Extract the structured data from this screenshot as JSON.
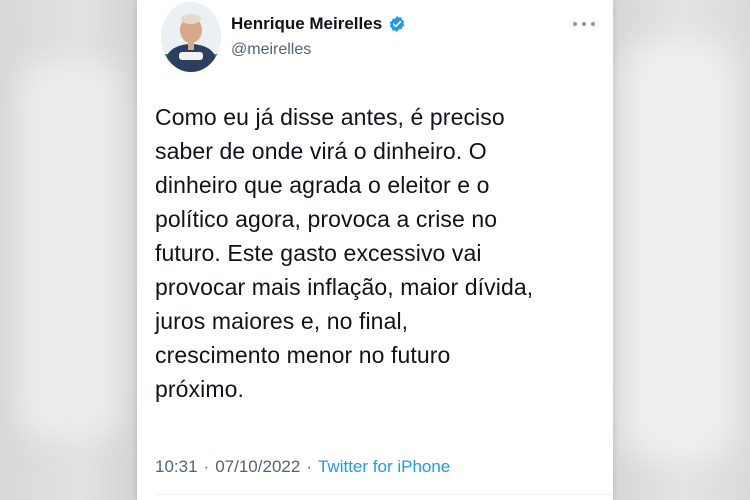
{
  "tweet": {
    "author": {
      "name": "Henrique Meirelles",
      "handle": "@meirelles",
      "verified": true
    },
    "text": "Como eu já disse antes, é preciso\nsaber de onde virá o dinheiro. O\ndinheiro que agrada o eleitor e o\npolítico agora, provoca a crise no\nfuturo. Este gasto excessivo vai\nprovocar mais inflação, maior dívida,\njuros maiores e, no final,\ncrescimento menor no futuro\npróximo.",
    "time": "10:31",
    "separator": "·",
    "date": "07/10/2022",
    "source": "Twitter for iPhone",
    "more_icon": "more-horizontal-icon",
    "verified_icon": "verified-badge-icon"
  },
  "colors": {
    "verified": "#1d9bf0",
    "link": "#1d9bf0",
    "text_primary": "#0f1419",
    "text_secondary": "#536471"
  }
}
